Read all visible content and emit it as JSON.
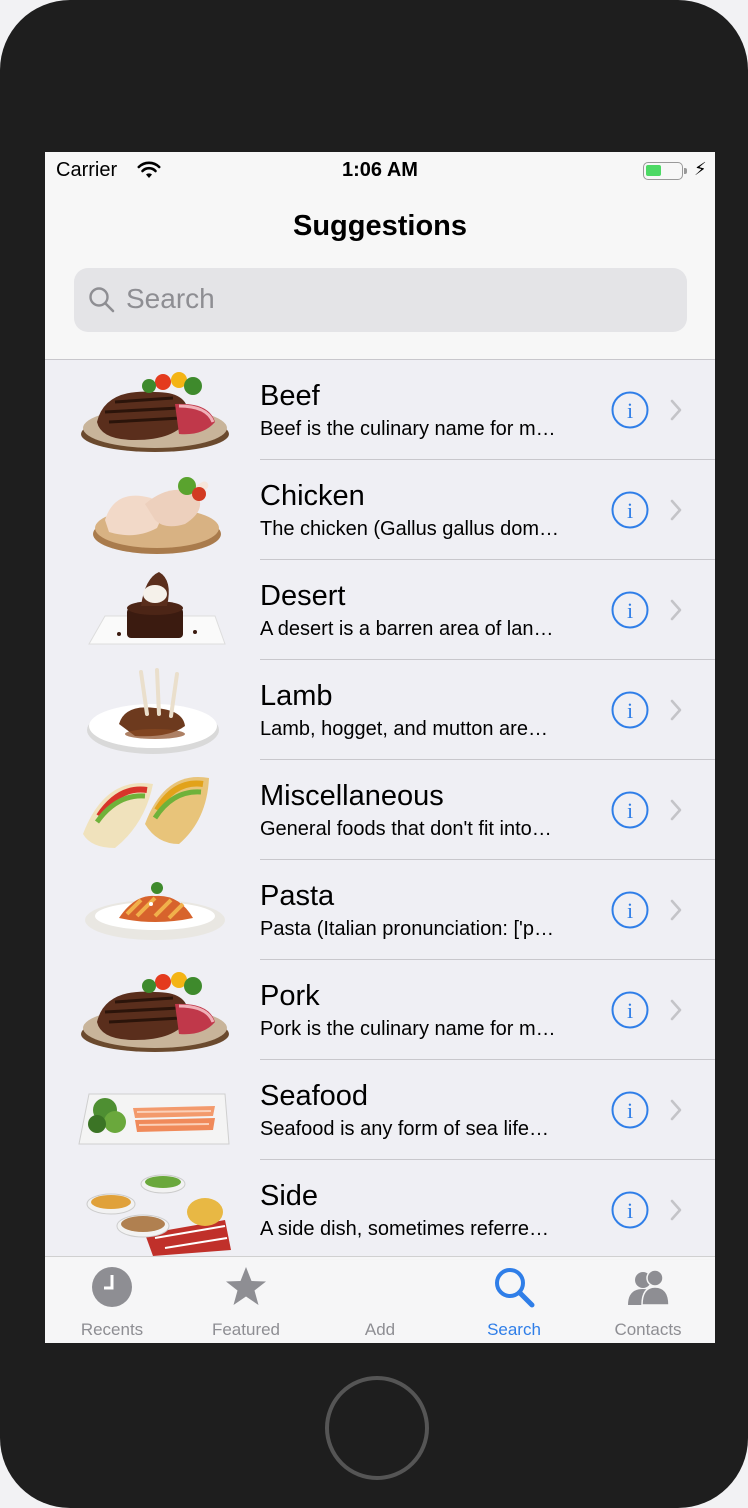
{
  "status_bar": {
    "carrier": "Carrier",
    "time": "1:06 AM",
    "wifi_icon": "wifi-icon",
    "battery_icon": "battery-charging-icon",
    "charging_glyph": "⚡"
  },
  "nav": {
    "title": "Suggestions"
  },
  "search": {
    "placeholder": "Search",
    "icon": "magnifier-icon"
  },
  "items": [
    {
      "title": "Beef",
      "subtitle": "Beef is the culinary name for m…",
      "thumb": "steak"
    },
    {
      "title": "Chicken",
      "subtitle": "The chicken (Gallus gallus dom…",
      "thumb": "chicken"
    },
    {
      "title": "Desert",
      "subtitle": "A desert is a barren area of lan…",
      "thumb": "cake"
    },
    {
      "title": "Lamb",
      "subtitle": "Lamb, hogget, and mutton are…",
      "thumb": "lamb"
    },
    {
      "title": "Miscellaneous",
      "subtitle": "General foods that don't fit into…",
      "thumb": "tacos"
    },
    {
      "title": "Pasta",
      "subtitle": "Pasta (Italian pronunciation: ['p…",
      "thumb": "pasta"
    },
    {
      "title": "Pork",
      "subtitle": "Pork is the culinary name for m…",
      "thumb": "steak"
    },
    {
      "title": "Seafood",
      "subtitle": "Seafood is any form of sea life…",
      "thumb": "salmon"
    },
    {
      "title": "Side",
      "subtitle": "A side dish, sometimes referre…",
      "thumb": "sides"
    }
  ],
  "tabs": [
    {
      "label": "Recents",
      "icon": "clock-icon",
      "active": false
    },
    {
      "label": "Featured",
      "icon": "star-icon",
      "active": false
    },
    {
      "label": "Add",
      "icon": "",
      "active": false
    },
    {
      "label": "Search",
      "icon": "search-icon",
      "active": true
    },
    {
      "label": "Contacts",
      "icon": "contacts-icon",
      "active": false
    }
  ],
  "colors": {
    "accent": "#2f7ee8",
    "inactive": "#8e8e93",
    "battery_fill": "#4cd964",
    "device_frame": "#1e1e1e"
  }
}
